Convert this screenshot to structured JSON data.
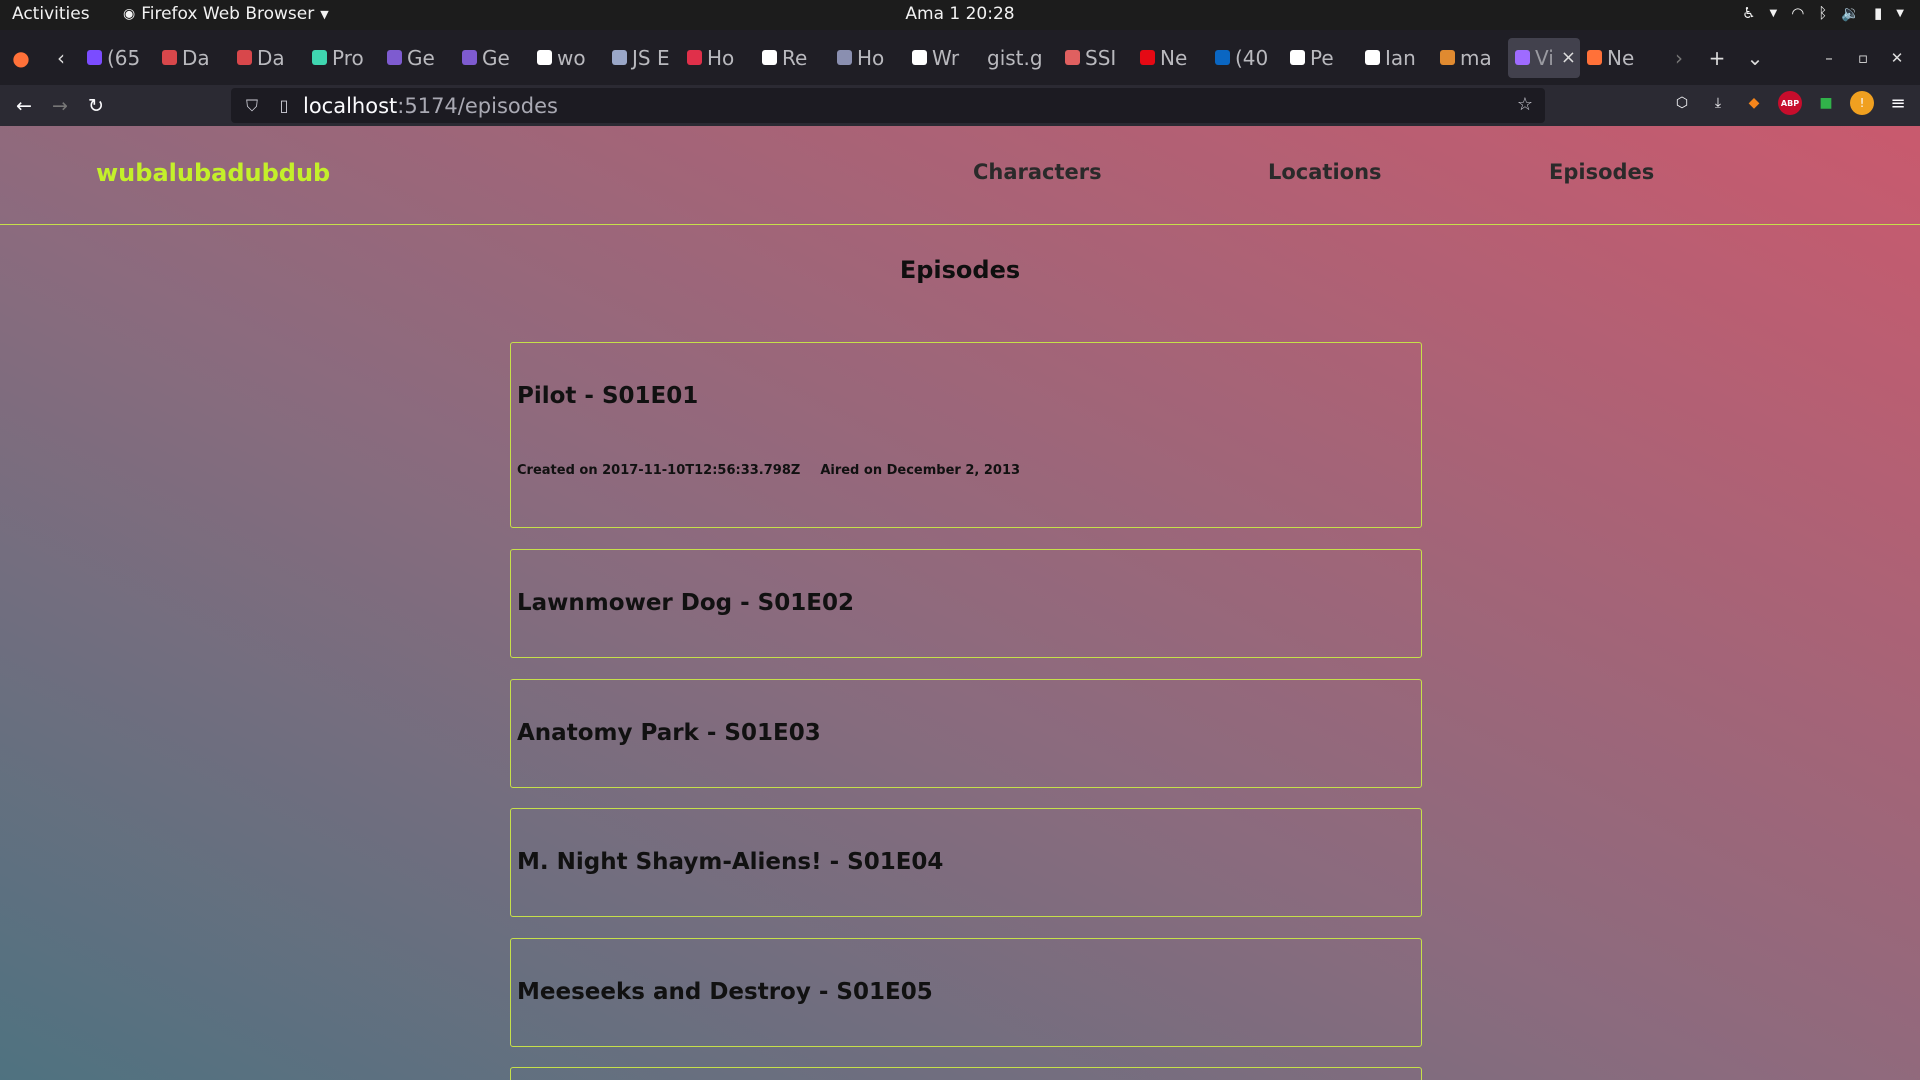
{
  "system_bar": {
    "activities": "Activities",
    "app_name": "Firefox Web Browser",
    "clock": "Ama 1  20:28"
  },
  "tabs": [
    {
      "label": "(65",
      "color": "#7b4cff"
    },
    {
      "label": "Da",
      "color": "#d8474b"
    },
    {
      "label": "Da",
      "color": "#d8474b"
    },
    {
      "label": "Pro",
      "color": "#3fd6b0"
    },
    {
      "label": "Ge",
      "color": "#7e5bd0"
    },
    {
      "label": "Ge",
      "color": "#7e5bd0"
    },
    {
      "label": "wo",
      "color": "#ffffff"
    },
    {
      "label": "JS E",
      "color": "#9aa7c8"
    },
    {
      "label": "Ho",
      "color": "#e0304a"
    },
    {
      "label": "Re",
      "color": "#ffffff"
    },
    {
      "label": "Ho",
      "color": "#8a8fb0"
    },
    {
      "label": "Wr",
      "color": "#ffffff"
    },
    {
      "label": "gist.g",
      "color": ""
    },
    {
      "label": "SSI",
      "color": "#e06060"
    },
    {
      "label": "Ne",
      "color": "#e50914"
    },
    {
      "label": "(40",
      "color": "#0a66c2"
    },
    {
      "label": "Pe",
      "color": "#ffffff"
    },
    {
      "label": "Ian",
      "color": "#ffffff"
    },
    {
      "label": "ma",
      "color": "#e08a30"
    },
    {
      "label": "Vi",
      "color": "#9f6bff",
      "active": true
    },
    {
      "label": "Ne",
      "color": "#ff7139"
    }
  ],
  "url": {
    "host": "localhost",
    "path": ":5174/episodes"
  },
  "site": {
    "brand": "wubalubadubdub",
    "nav": [
      "Characters",
      "Locations",
      "Episodes"
    ],
    "page_title": "Episodes",
    "accent_color": "#c4f02a"
  },
  "episodes": [
    {
      "title": "Pilot - S01E01",
      "created": "Created on 2017-11-10T12:56:33.798Z",
      "aired": "Aired on December 2, 2013",
      "expanded": true
    },
    {
      "title": "Lawnmower Dog - S01E02"
    },
    {
      "title": "Anatomy Park - S01E03"
    },
    {
      "title": "M. Night Shaym-Aliens! - S01E04"
    },
    {
      "title": "Meeseeks and Destroy - S01E05"
    }
  ]
}
